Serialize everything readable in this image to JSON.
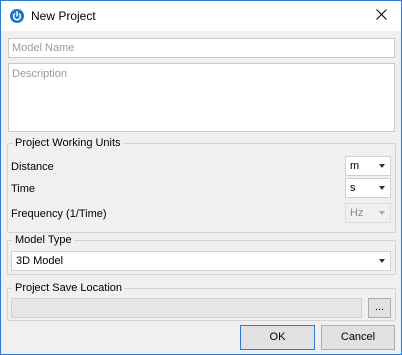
{
  "dialog": {
    "title": "New Project",
    "icon": "power-icon",
    "close_icon": "close-icon",
    "accent": "#2b79d8"
  },
  "model_name": {
    "value": "",
    "placeholder": "Model Name"
  },
  "description": {
    "value": "",
    "placeholder": "Description"
  },
  "units": {
    "title": "Project Working Units",
    "distance": {
      "label": "Distance",
      "value": "m"
    },
    "time": {
      "label": "Time",
      "value": "s"
    },
    "frequency": {
      "label": "Frequency (1/Time)",
      "value": "Hz",
      "disabled": true
    }
  },
  "model_type": {
    "title": "Model Type",
    "value": "3D Model"
  },
  "save_location": {
    "title": "Project Save Location",
    "path": "",
    "browse_label": "..."
  },
  "buttons": {
    "ok": "OK",
    "cancel": "Cancel"
  }
}
